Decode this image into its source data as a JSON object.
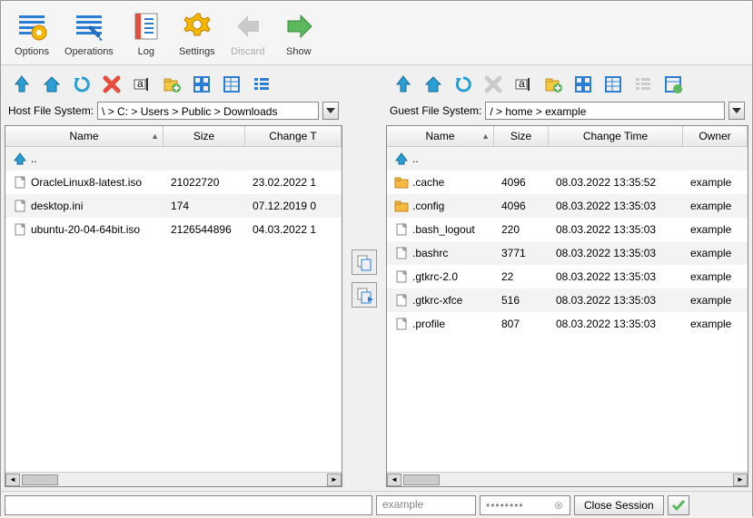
{
  "toolbar": [
    {
      "id": "options",
      "label": "Options",
      "disabled": false
    },
    {
      "id": "operations",
      "label": "Operations",
      "disabled": false
    },
    {
      "id": "log",
      "label": "Log",
      "disabled": false
    },
    {
      "id": "settings",
      "label": "Settings",
      "disabled": false
    },
    {
      "id": "discard",
      "label": "Discard",
      "disabled": true
    },
    {
      "id": "show",
      "label": "Show",
      "disabled": false
    }
  ],
  "left": {
    "path_label": "Host File System:",
    "path": "\\ > C: > Users > Public > Downloads",
    "columns": {
      "name": "Name",
      "size": "Size",
      "change": "Change T"
    },
    "rows": [
      {
        "icon": "up",
        "name": "..",
        "size": "",
        "change": ""
      },
      {
        "icon": "file",
        "name": "OracleLinux8-latest.iso",
        "size": "21022720",
        "change": "23.02.2022 1"
      },
      {
        "icon": "file",
        "name": "desktop.ini",
        "size": "174",
        "change": "07.12.2019 0"
      },
      {
        "icon": "file",
        "name": "ubuntu-20-04-64bit.iso",
        "size": "2126544896",
        "change": "04.03.2022 1"
      }
    ]
  },
  "right": {
    "path_label": "Guest File System:",
    "path": "/ > home > example",
    "columns": {
      "name": "Name",
      "size": "Size",
      "change": "Change Time",
      "owner": "Owner"
    },
    "rows": [
      {
        "icon": "up",
        "name": "..",
        "size": "",
        "change": "",
        "owner": ""
      },
      {
        "icon": "folder",
        "name": ".cache",
        "size": "4096",
        "change": "08.03.2022 13:35:52",
        "owner": "example"
      },
      {
        "icon": "folder",
        "name": ".config",
        "size": "4096",
        "change": "08.03.2022 13:35:03",
        "owner": "example"
      },
      {
        "icon": "file",
        "name": ".bash_logout",
        "size": "220",
        "change": "08.03.2022 13:35:03",
        "owner": "example"
      },
      {
        "icon": "file",
        "name": ".bashrc",
        "size": "3771",
        "change": "08.03.2022 13:35:03",
        "owner": "example"
      },
      {
        "icon": "file",
        "name": ".gtkrc-2.0",
        "size": "22",
        "change": "08.03.2022 13:35:03",
        "owner": "example"
      },
      {
        "icon": "file",
        "name": ".gtkrc-xfce",
        "size": "516",
        "change": "08.03.2022 13:35:03",
        "owner": "example"
      },
      {
        "icon": "file",
        "name": ".profile",
        "size": "807",
        "change": "08.03.2022 13:35:03",
        "owner": "example"
      }
    ]
  },
  "bottom": {
    "user": "example",
    "password": "••••••••",
    "close_label": "Close Session"
  }
}
